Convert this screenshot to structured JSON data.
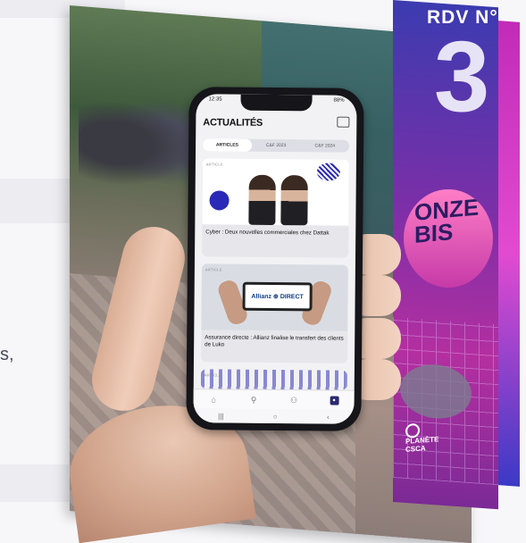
{
  "background": {
    "text_fragment": "s,"
  },
  "poster": {
    "title": "RDV N°",
    "number": "3",
    "badge_text": "ONZE BIS",
    "brand": "PLANÈTE CSCA"
  },
  "phone": {
    "status": {
      "time": "12:35",
      "battery": "88%"
    },
    "app_title": "ACTUALITÉS",
    "tabs": [
      {
        "label": "ARTICLES",
        "active": true
      },
      {
        "label": "C&F 2023",
        "active": false
      },
      {
        "label": "C&F 2024",
        "active": false
      }
    ],
    "articles": [
      {
        "tag": "ARTICLE",
        "caption": "Cyber : Deux nouvelles commerciales chez Dattak"
      },
      {
        "tag": "ARTICLE",
        "caption": "Assurance directe : Allianz finalise le transfert des clients de Luko",
        "sign_text": "Allianz ⊕ DIRECT"
      },
      {
        "tag": "ARTICLE",
        "caption": ""
      }
    ],
    "tabbar_icons": [
      "home-icon",
      "search-icon",
      "people-icon",
      "profile-icon"
    ],
    "system_nav": {
      "recents": "|||",
      "home": "○",
      "back": "‹"
    }
  }
}
